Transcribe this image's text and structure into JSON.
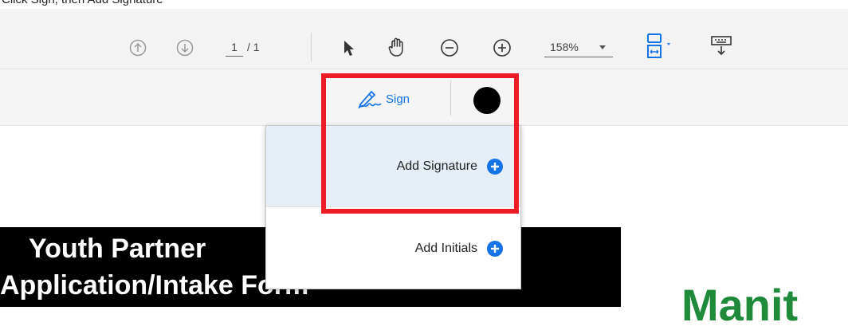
{
  "caption": "Click Sign, then Add Signature",
  "toolbar": {
    "prev_page_icon": "arrow-up-circle-icon",
    "next_page_icon": "arrow-down-circle-icon",
    "page_current": "1",
    "page_total": "/ 1",
    "select_icon": "cursor-arrow-icon",
    "hand_icon": "hand-icon",
    "zoom_out_icon": "zoom-out-icon",
    "zoom_in_icon": "zoom-in-icon",
    "zoom_value": "158%",
    "fit_icon": "fit-page-icon",
    "keyboard_icon": "keyboard-icon"
  },
  "signbar": {
    "sign_label": "Sign",
    "color": "#000000"
  },
  "menu": {
    "add_signature": "Add Signature",
    "add_initials": "Add Initials"
  },
  "document": {
    "title_line1": "Youth Partner",
    "title_line2": "Application/Intake Form",
    "logo_text": "Manit"
  },
  "colors": {
    "accent": "#1473e6",
    "highlight": "#ee1c25",
    "logo": "#1f8a3a"
  }
}
